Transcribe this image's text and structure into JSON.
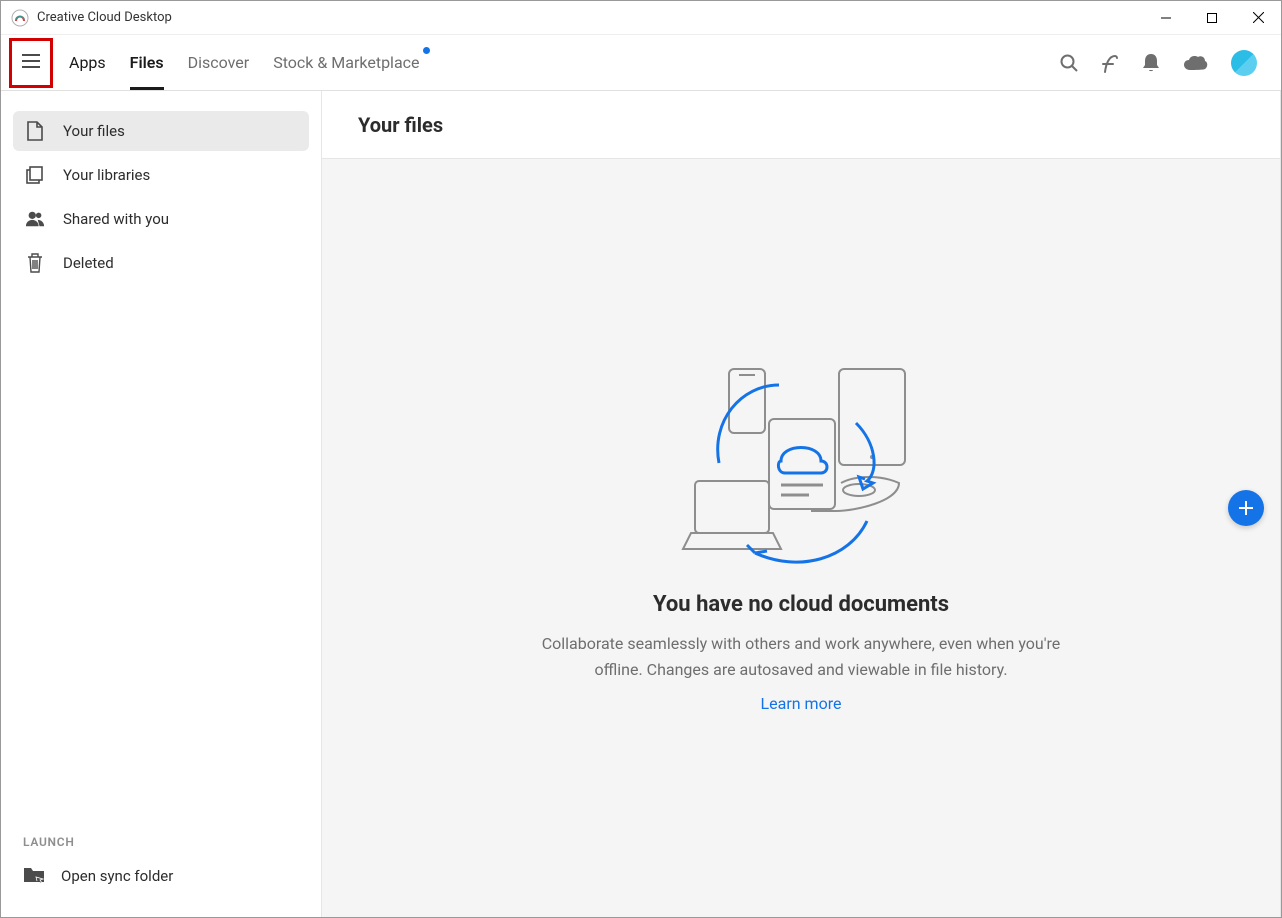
{
  "window": {
    "title": "Creative Cloud Desktop"
  },
  "nav": {
    "tabs": [
      {
        "label": "Apps"
      },
      {
        "label": "Files"
      },
      {
        "label": "Discover"
      },
      {
        "label": "Stock & Marketplace"
      }
    ]
  },
  "sidebar": {
    "items": [
      {
        "label": "Your files"
      },
      {
        "label": "Your libraries"
      },
      {
        "label": "Shared with you"
      },
      {
        "label": "Deleted"
      }
    ],
    "launch_label": "LAUNCH",
    "sync_label": "Open sync folder"
  },
  "main": {
    "title": "Your files",
    "empty_title": "You have no cloud documents",
    "empty_desc": "Collaborate seamlessly with others and work anywhere, even when you're offline. Changes are autosaved and viewable in file history.",
    "learn_more": "Learn more"
  }
}
